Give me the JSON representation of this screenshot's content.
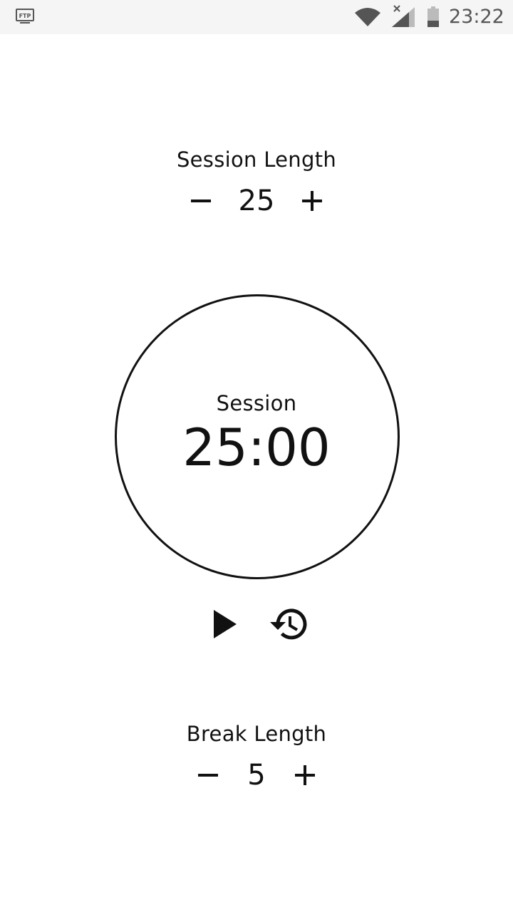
{
  "status_bar": {
    "time": "23:22",
    "icons": [
      "ftp-icon",
      "wifi-icon",
      "cell-signal-icon",
      "battery-icon"
    ],
    "icon_color": "#555555"
  },
  "session_length": {
    "label": "Session Length",
    "value": "25",
    "decrement_icon": "minus-icon",
    "increment_icon": "plus-icon"
  },
  "timer": {
    "mode_label": "Session",
    "time": "25:00"
  },
  "controls": {
    "play_icon": "play-icon",
    "reset_icon": "history-icon"
  },
  "break_length": {
    "label": "Break Length",
    "value": "5",
    "decrement_icon": "minus-icon",
    "increment_icon": "plus-icon"
  },
  "colors": {
    "background": "#ffffff",
    "foreground": "#111111",
    "status_bar_bg": "#f5f5f5"
  }
}
